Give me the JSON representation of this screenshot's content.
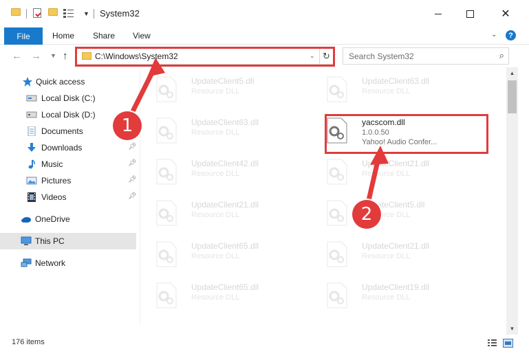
{
  "window": {
    "title": "System32"
  },
  "ribbon": {
    "tabs": [
      {
        "label": "File"
      },
      {
        "label": "Home"
      },
      {
        "label": "Share"
      },
      {
        "label": "View"
      }
    ],
    "help_label": "?"
  },
  "address_bar": {
    "path": "C:\\Windows\\System32"
  },
  "search": {
    "placeholder": "Search System32"
  },
  "sidebar": {
    "items": [
      {
        "label": "Quick access",
        "icon": "star-icon"
      },
      {
        "label": "Local Disk (C:)",
        "icon": "drive-icon"
      },
      {
        "label": "Local Disk (D:)",
        "icon": "drive-icon"
      },
      {
        "label": "Documents",
        "icon": "documents-icon",
        "pinned": true
      },
      {
        "label": "Downloads",
        "icon": "download-icon",
        "pinned": true
      },
      {
        "label": "Music",
        "icon": "music-icon",
        "pinned": true
      },
      {
        "label": "Pictures",
        "icon": "pictures-icon",
        "pinned": true
      },
      {
        "label": "Videos",
        "icon": "videos-icon",
        "pinned": true
      },
      {
        "label": "OneDrive",
        "icon": "cloud-icon"
      },
      {
        "label": "This PC",
        "icon": "computer-icon",
        "selected": true
      },
      {
        "label": "Network",
        "icon": "network-icon"
      }
    ]
  },
  "files": {
    "left": [
      {
        "name": "UpdateClient5.dll",
        "type": "Resource DLL"
      },
      {
        "name": "UpdateClient63.dll",
        "type": "Resource DLL"
      },
      {
        "name": "UpdateClient42.dll",
        "type": "Resource DLL"
      },
      {
        "name": "UpdateClient21.dll",
        "type": "Resource DLL"
      },
      {
        "name": "UpdateClient65.dll",
        "type": "Resource DLL"
      },
      {
        "name": "UpdateClient65.dll",
        "type": "Resource DLL"
      }
    ],
    "right": [
      {
        "name": "UpdateClient63.dll",
        "type": "Resource DLL"
      },
      {
        "name": "yacscom.dll",
        "version": "1.0.0.50",
        "description": "Yahoo! Audio Confer..."
      },
      {
        "name": "UpdateClient21.dll",
        "type": "Resource DLL"
      },
      {
        "name": "UpdateClient5.dll",
        "type": "Resource DLL"
      },
      {
        "name": "UpdateClient21.dll",
        "type": "Resource DLL"
      },
      {
        "name": "UpdateClient19.dll",
        "type": "Resource DLL"
      }
    ]
  },
  "status": {
    "item_count": "176 items"
  },
  "annotations": {
    "step1": "1",
    "step2": "2",
    "color": "#e23b3b"
  },
  "colors": {
    "accent": "#1979ca",
    "highlight": "#e23b3b",
    "selected_bg": "#e5e5e5"
  }
}
